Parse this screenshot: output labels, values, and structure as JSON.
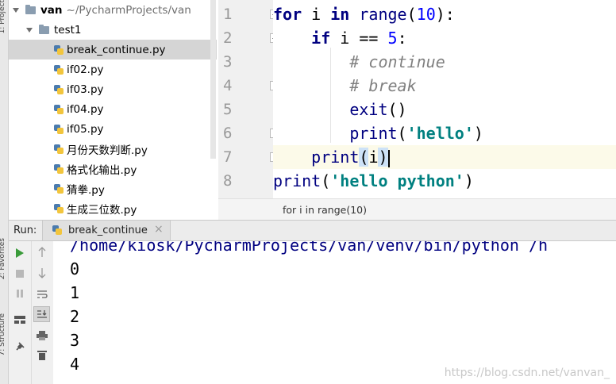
{
  "side_strip": {
    "project_tab": "1: Project",
    "favorites_tab": "2: Favorites",
    "structure_tab": "7: Structure"
  },
  "project_tree": {
    "root": {
      "name": "van",
      "path": "~/PycharmProjects/van"
    },
    "folder": "test1",
    "files": [
      "break_continue.py",
      "if02.py",
      "if03.py",
      "if04.py",
      "if05.py",
      "月份天数判断.py",
      "格式化输出.py",
      "猜拳.py",
      "生成三位数.py"
    ],
    "selected_index": 0
  },
  "editor": {
    "line_numbers": [
      "1",
      "2",
      "3",
      "4",
      "5",
      "6",
      "7",
      "8"
    ],
    "lines": {
      "l1": {
        "kw1": "for",
        "sp1": " i ",
        "kw2": "in",
        "sp2": " ",
        "fn": "range",
        "p1": "(",
        "num": "10",
        "p2": "):"
      },
      "l2": {
        "indent": "    ",
        "kw": "if",
        "rest": " i == ",
        "num": "5",
        "colon": ":"
      },
      "l3": {
        "indent": "        ",
        "comment": "# continue"
      },
      "l4": {
        "indent": "        ",
        "comment": "# break"
      },
      "l5": {
        "indent": "        ",
        "fn": "exit",
        "args": "()"
      },
      "l6": {
        "indent": "        ",
        "fn": "print",
        "p1": "(",
        "str": "'hello'",
        "p2": ")"
      },
      "l7": {
        "indent": "    ",
        "fn": "print",
        "p1": "(",
        "arg": "i",
        "p2": ")"
      },
      "l8": {
        "fn": "print",
        "p1": "(",
        "str": "'hello python'",
        "p2": ")"
      }
    }
  },
  "breadcrumb": "for i in range(10)",
  "run_panel": {
    "label": "Run:",
    "tab_name": "break_continue",
    "close_glyph": "×",
    "console_lines": [
      "/home/kiosk/PycharmProjects/van/venv/bin/python /h",
      "0",
      "1",
      "2",
      "3",
      "4"
    ]
  },
  "watermark": "https://blog.csdn.net/vanvan_",
  "colors": {
    "keyword": "#000080",
    "string": "#008080",
    "comment": "#808080",
    "run_icon": "#3a9b3a",
    "selection": "#d5d5d5"
  }
}
